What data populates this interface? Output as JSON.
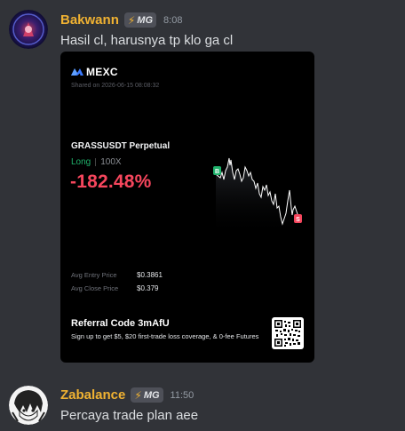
{
  "messages": [
    {
      "username": "Bakwann",
      "role_tag": "MG",
      "timestamp": "8:08",
      "text": "Hasil cl, harusnya tp klo ga cl",
      "name_color": "#f0b232"
    },
    {
      "username": "Zabalance",
      "role_tag": "MG",
      "timestamp": "11:50",
      "text": "Percaya trade plan aee",
      "name_color": "#f0b232"
    }
  ],
  "card": {
    "brand": "MEXC",
    "shared_on": "Shared on 2026-06-15 08:08:32",
    "pair": "GRASSUSDT Perpetual",
    "side": "Long",
    "leverage": "100X",
    "pnl": "-182.48%",
    "entry_label": "Avg Entry Price",
    "entry_value": "$0.3861",
    "close_label": "Avg Close Price",
    "close_value": "$0.379",
    "referral_title": "Referral Code 3mAfU",
    "referral_desc": "Sign up to get $5, $20 first-trade loss coverage, & 0-fee Futures",
    "buy_marker": "B",
    "sell_marker": "S",
    "colors": {
      "profit": "#20b26c",
      "loss": "#f6465d"
    }
  }
}
